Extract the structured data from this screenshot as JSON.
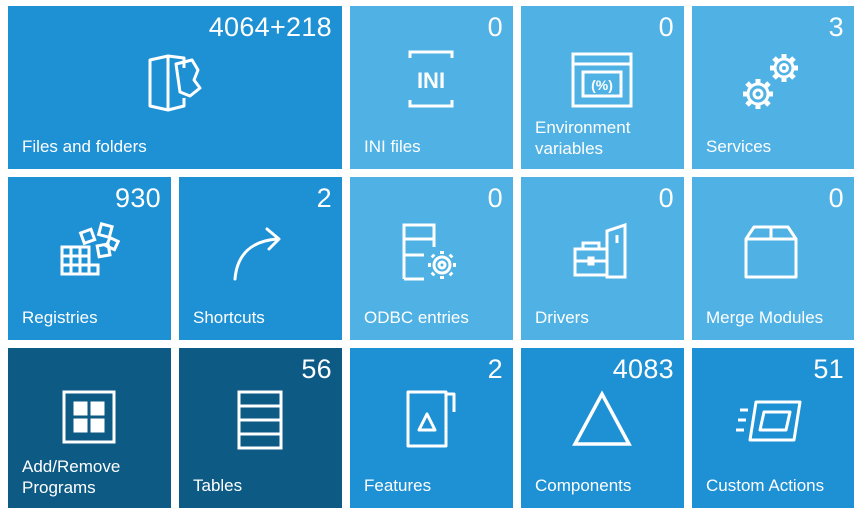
{
  "colors": {
    "mid": "#1e90d4",
    "light": "#4fb1e4",
    "dark": "#0d5a85",
    "text": "#ffffff"
  },
  "tiles": [
    {
      "label": "Files and folders",
      "count": "4064+218",
      "icon": "files-and-folders-icon"
    },
    {
      "label": "INI files",
      "count": "0",
      "icon": "ini-icon"
    },
    {
      "label": "Environment variables",
      "count": "0",
      "icon": "environment-variables-icon"
    },
    {
      "label": "Services",
      "count": "3",
      "icon": "gears-icon"
    },
    {
      "label": "Registries",
      "count": "930",
      "icon": "registry-icon"
    },
    {
      "label": "Shortcuts",
      "count": "2",
      "icon": "shortcut-arrow-icon"
    },
    {
      "label": "ODBC entries",
      "count": "0",
      "icon": "odbc-icon"
    },
    {
      "label": "Drivers",
      "count": "0",
      "icon": "drivers-icon"
    },
    {
      "label": "Merge Modules",
      "count": "0",
      "icon": "merge-modules-box-icon"
    },
    {
      "label": "Add/Remove Programs",
      "count": "",
      "icon": "add-remove-programs-icon"
    },
    {
      "label": "Tables",
      "count": "56",
      "icon": "tables-icon"
    },
    {
      "label": "Features",
      "count": "2",
      "icon": "features-icon"
    },
    {
      "label": "Components",
      "count": "4083",
      "icon": "components-triangle-icon"
    },
    {
      "label": "Custom Actions",
      "count": "51",
      "icon": "custom-actions-icon"
    }
  ]
}
